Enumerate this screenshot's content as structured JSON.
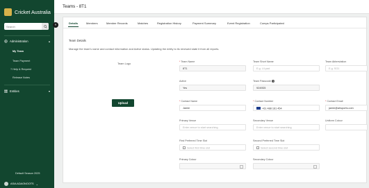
{
  "sidebar": {
    "brand": "Cricket Australia",
    "search_placeholder": "Search",
    "collapse_symbol": "«",
    "nav": {
      "administration": "Administration",
      "my_team": "My Team",
      "team_payment": "Team Payment",
      "help_request": "Help & Request",
      "release_notes": "Release Notes",
      "entities": "Entities"
    },
    "environment": "Default Season 2025",
    "user_name": "ASIA ADAONOOTS"
  },
  "header": {
    "title": "Teams - 8T1"
  },
  "tabs": [
    "Details",
    "Members",
    "Member Records",
    "Matches",
    "Registration History",
    "Payment Summary",
    "Event Registration",
    "Comps Participated"
  ],
  "details": {
    "section_title": "Team Details",
    "section_desc": "Manage the team's name and contact information and Active status. Updating the entity to its renewed state it from all reports.",
    "team_logo_label": "Team Logo",
    "upload_label": "Upload",
    "fields": {
      "team_name": {
        "label": "Team Name",
        "value": "8T1"
      },
      "team_short_name": {
        "label": "Team Short Name",
        "placeholder": "E.g. Lil-pad"
      },
      "team_abbreviation": {
        "label": "Team Abbreviation",
        "placeholder": "E.g. SG1"
      },
      "active": {
        "label": "Active",
        "value": "Yes"
      },
      "team_passcode": {
        "label": "Team Passcode",
        "value": "9249D5"
      },
      "contact_name": {
        "label": "Contact Name",
        "value": "Jamie"
      },
      "contact_number": {
        "label": "Contact Number",
        "value": "+61 488 161 454"
      },
      "contact_email": {
        "label": "Contact Email",
        "value": "jamie@ahsports.com"
      },
      "primary_venue": {
        "label": "Primary Venue",
        "placeholder": "Enter venue to start searching"
      },
      "secondary_venue": {
        "label": "Secondary Venue",
        "placeholder": "Enter venue to start searching"
      },
      "uniform_colour": {
        "label": "Uniform Colour"
      },
      "first_preferred_time_slot": {
        "label": "First Preferred Time Slot",
        "placeholder": "Select first time slot"
      },
      "second_preferred_time_slot": {
        "label": "Second Preferred Time Slot",
        "placeholder": "Select second time slot"
      },
      "primary_colour": {
        "label": "Primary Colour"
      },
      "secondary_colour": {
        "label": "Secondary Colour"
      }
    }
  },
  "colors": {
    "sidebar_bg": "#12462f",
    "accent": "#12462f",
    "brand_logo": "#d7b24a",
    "required": "#dd3333"
  },
  "icons": [
    "brand-logo-icon",
    "search-icon",
    "administration-icon",
    "entities-icon",
    "info-icon",
    "calendar-icon",
    "au-flag-icon",
    "colour-picker-icon",
    "chevron-down-icon"
  ]
}
